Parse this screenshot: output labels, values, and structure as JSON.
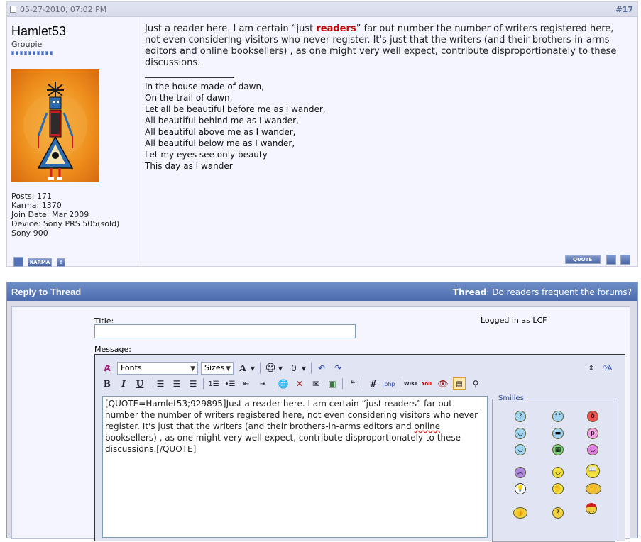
{
  "post": {
    "date": "05-27-2010, 07:02 PM",
    "number": "#17",
    "username": "Hamlet53",
    "usertitle": "Groupie",
    "reputation_pips": 10,
    "stats": [
      "Posts: 171",
      "Karma: 1370",
      "Join Date: Mar 2009",
      "Device: Sony PRS 505(sold)",
      "Sony 900"
    ],
    "body_pre": "Just a reader here. I am certain “just ",
    "body_bold": "readers",
    "body_post": "” far out number the number of writers registered here, not even considering visitors who never register. It's just that the writers (and their brothers-in-arms editors and online booksellers) , as one might very well expect, contribute disproportionately to these discussions.",
    "signature": [
      "In the house made of dawn,",
      "On the trail of dawn,",
      "Let all be beautiful before me as I wander,",
      "All beautiful behind me as I wander,",
      "All beautiful above me as I wander,",
      "All beautiful below me as I wander,",
      "Let my eyes see only beauty",
      "This day as I wander"
    ],
    "karma_label": "KARMA",
    "quote_label": "QUOTE"
  },
  "reply": {
    "header": "Reply to Thread",
    "thread_label": "Thread",
    "thread_title": "Do readers frequent the forums?",
    "title_label": "Title:",
    "title_value": "",
    "logged_in": "Logged in as LCF",
    "message_label": "Message:",
    "fonts_label": "Fonts",
    "sizes_label": "Sizes",
    "message_pre": "[QUOTE=Hamlet53;929895]Just a reader here.  I am certain “just readers” far out number the number of writers registered here, not even considering visitors who never register.  It's just that the writers (and their brothers-in-arms editors and ",
    "message_squig": "online",
    "message_post": " booksellers) , as one might very well expect, contribute disproportionately  to these discussions.[/QUOTE]",
    "smilies_label": "Smilies"
  },
  "colors": {
    "accent": "#4a6bae",
    "highlight": "#cc0000",
    "rep": "#4a6dc4"
  }
}
